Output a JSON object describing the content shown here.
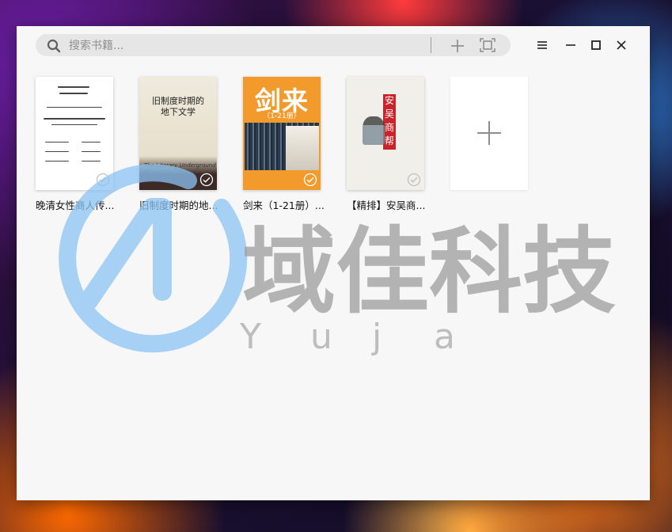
{
  "search": {
    "placeholder": "搜索书籍..."
  },
  "window_controls": [
    "menu-icon",
    "minimize-icon",
    "maximize-icon",
    "close-icon"
  ],
  "books": [
    {
      "title": "晚清女性商人传...",
      "cover_style": "white-document"
    },
    {
      "title": "旧制度时期的地...",
      "cover_style": "beige",
      "cover_text": [
        "旧制度时期的",
        "地下文学"
      ],
      "cover_subtitle": [
        "The Literary Underground of",
        "the Old Regime"
      ]
    },
    {
      "title": "剑来（1-21册）...",
      "cover_style": "orange",
      "cover_big": "剑来",
      "cover_vol": "（1-21册）"
    },
    {
      "title": "【精排】安吴商...",
      "cover_style": "cream",
      "cover_vertical": [
        "安",
        "吴",
        "商",
        "帮"
      ]
    }
  ],
  "add_tile": {
    "icon": "plus-icon"
  },
  "watermark": {
    "brand": "域佳科技",
    "latin": [
      "Y",
      "u",
      "j",
      "a"
    ],
    "color": "#8cc3f4"
  },
  "colors": {
    "window_bg": "#f7f7f7",
    "search_bg": "#e6e6e6",
    "cover3_bg": "#f39a2d",
    "cover4_red": "#c8242b"
  }
}
